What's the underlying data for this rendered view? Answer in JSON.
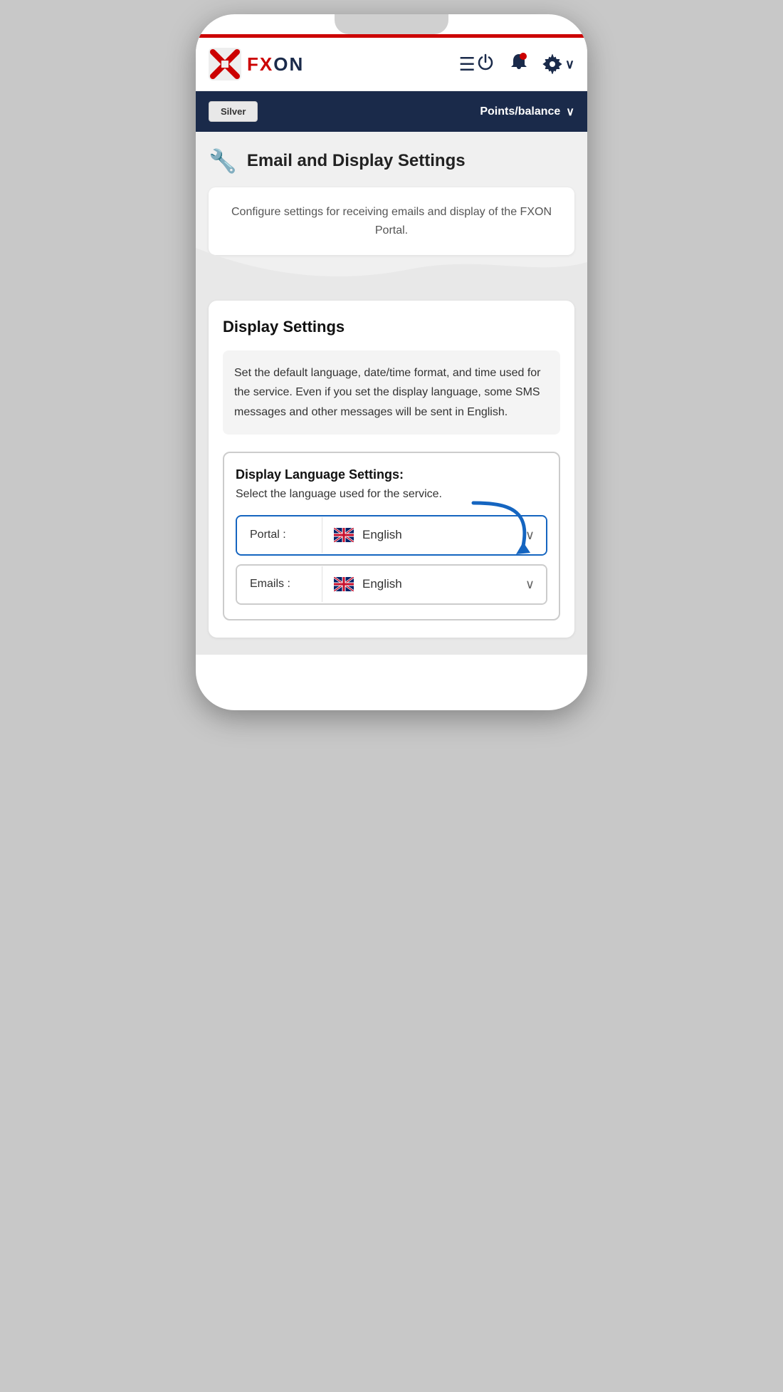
{
  "phone": {
    "red_bar": ""
  },
  "header": {
    "logo_text": "FXON",
    "hamburger_label": "☰",
    "icons": {
      "power": "⏻",
      "bell": "🔔",
      "gear": "⚙",
      "chevron": "∨"
    }
  },
  "status_bar": {
    "badge_label": "Silver",
    "points_label": "Points/balance",
    "chevron": "∨"
  },
  "page_title": {
    "icon": "🔧",
    "title": "Email and Display Settings"
  },
  "description": {
    "text": "Configure settings for receiving emails and display of the FXON Portal."
  },
  "display_settings": {
    "section_title": "Display Settings",
    "info_text": "Set the default language, date/time format, and time used for the service. Even if you set the display language, some SMS messages and other messages will be sent in English.",
    "lang_box": {
      "title": "Display Language Settings:",
      "desc": "Select the language used for the service.",
      "portal_label": "Portal :",
      "portal_value": "English",
      "emails_label": "Emails :",
      "emails_value": "English"
    }
  }
}
